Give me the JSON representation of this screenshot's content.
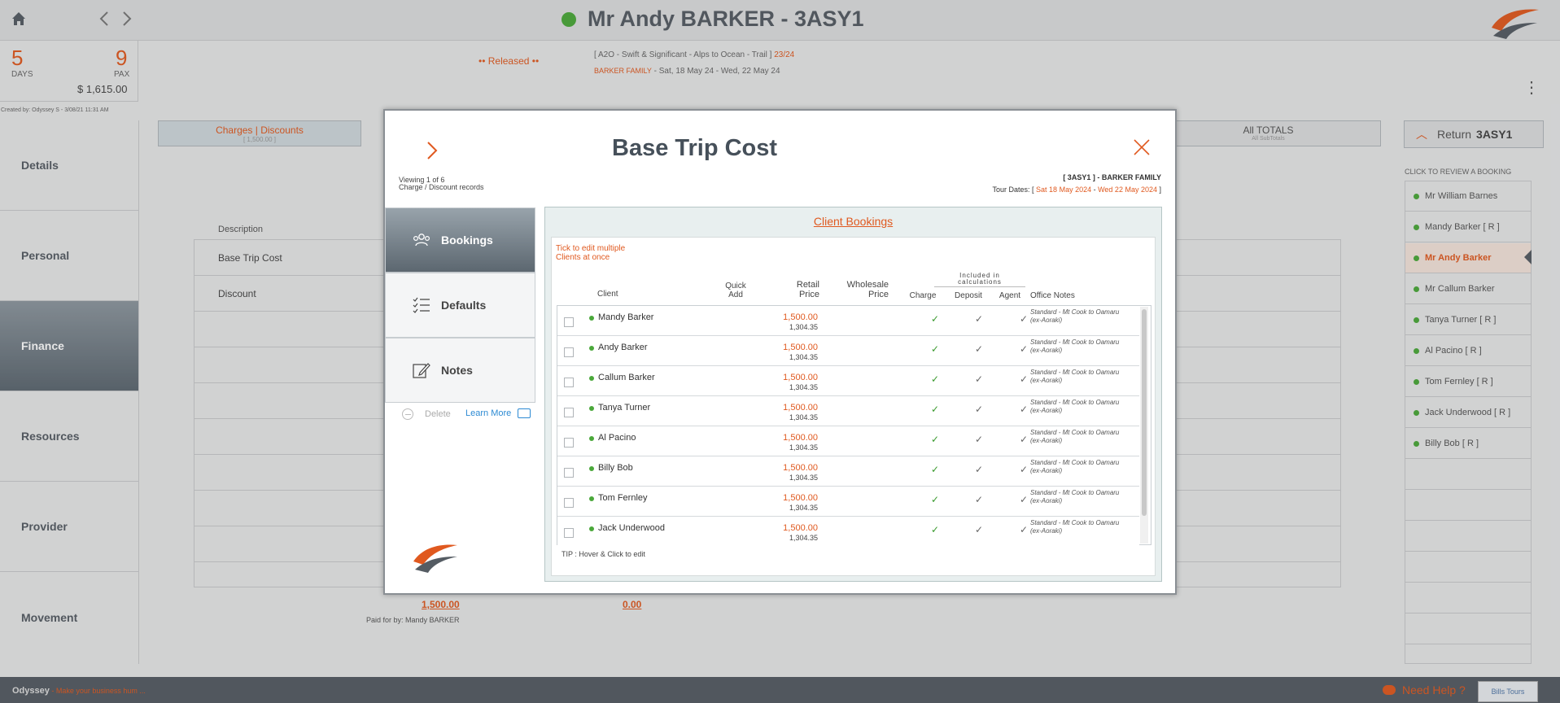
{
  "header": {
    "title": "Mr Andy BARKER - 3ASY1",
    "status_color": "#4aa83a"
  },
  "summary": {
    "days": "5",
    "days_label": "DAYS",
    "pax": "9",
    "pax_label": "PAX",
    "total": "$ 1,615.00",
    "created_by": "Created by: Odyssey S - 3/08/21 11:31 AM"
  },
  "nav": {
    "items": [
      {
        "label": "Details"
      },
      {
        "label": "Personal"
      },
      {
        "label": "Finance"
      },
      {
        "label": "Resources"
      },
      {
        "label": "Provider"
      },
      {
        "label": "Movement"
      }
    ]
  },
  "trip": {
    "released": "•• Released ••",
    "line1_prefix": "[ A2O - Swift & Significant - Alps to Ocean - Trail ]",
    "line1_code": "23/24",
    "line2_family": "BARKER FAMILY",
    "line2_dates": "- Sat, 18 May 24 - Wed, 22 May 24"
  },
  "tabs": {
    "charges_label": "Charges | Discounts",
    "charges_sub": "[ 1,500.00 ]",
    "alltotals_label": "All TOTALS",
    "alltotals_sub": "All SubTotals"
  },
  "background_table": {
    "desc_header": "Description",
    "rows": [
      "Base Trip Cost",
      "Discount"
    ],
    "sum1": "1,500.00",
    "sum2": "0.00",
    "paid_for": "Paid for by: Mandy BARKER"
  },
  "right_panel": {
    "return_label": "Return",
    "return_code": "3ASY1",
    "review_title": "CLICK TO REVIEW A BOOKING",
    "bookings": [
      "Mr William Barnes",
      "Mandy Barker  [ R ]",
      "Mr Andy Barker",
      "Mr Callum Barker",
      "Tanya Turner  [ R ]",
      "Al Pacino  [ R ]",
      "Tom Fernley  [ R ]",
      "Jack Underwood  [ R ]",
      "Billy Bob  [ R ]"
    ]
  },
  "footer": {
    "brand": "Odyssey",
    "tagline": " - Make your business hum ...",
    "help": "Need Help ?",
    "partner_logo": "Bills Tours"
  },
  "modal": {
    "title": "Base Trip Cost",
    "viewing_line1": "Viewing 1 of 6",
    "viewing_line2": "Charge / Discount records",
    "trip_code": "[ 3ASY1 ] - BARKER FAMILY",
    "tour_dates_prefix": "Tour Dates: [",
    "tour_date_start": "Sat 18 May 2024",
    "tour_date_sep": " - ",
    "tour_date_end": "Wed 22 May 2024",
    "tour_dates_suffix": " ]",
    "side_tabs": [
      {
        "label": "Bookings",
        "icon": "people-icon"
      },
      {
        "label": "Defaults",
        "icon": "list-icon"
      },
      {
        "label": "Notes",
        "icon": "edit-icon"
      }
    ],
    "delete_label": "Delete",
    "learn_more_label": "Learn More",
    "panel_title": "Client Bookings",
    "tick_note_1": "Tick to edit multiple",
    "tick_note_2": "Clients at once",
    "headers": {
      "client": "Client",
      "quick_add": "Quick\nAdd",
      "retail": "Retail\nPrice",
      "wholesale": "Wholesale\nPrice",
      "included": "Included in\ncalculations",
      "charge": "Charge",
      "deposit": "Deposit",
      "agent": "Agent",
      "office_notes": "Office Notes"
    },
    "clients": [
      {
        "name": "Mandy Barker",
        "retail": "1,500.00",
        "wholesale": "1,304.35",
        "notes": "Standard - Mt Cook to Oamaru (ex-Aoraki)"
      },
      {
        "name": "Andy Barker",
        "retail": "1,500.00",
        "wholesale": "1,304.35",
        "notes": "Standard - Mt Cook to Oamaru (ex-Aoraki)"
      },
      {
        "name": "Callum Barker",
        "retail": "1,500.00",
        "wholesale": "1,304.35",
        "notes": "Standard - Mt Cook to Oamaru (ex-Aoraki)"
      },
      {
        "name": "Tanya Turner",
        "retail": "1,500.00",
        "wholesale": "1,304.35",
        "notes": "Standard - Mt Cook to Oamaru (ex-Aoraki)"
      },
      {
        "name": "Al Pacino",
        "retail": "1,500.00",
        "wholesale": "1,304.35",
        "notes": "Standard - Mt Cook to Oamaru (ex-Aoraki)"
      },
      {
        "name": "Billy Bob",
        "retail": "1,500.00",
        "wholesale": "1,304.35",
        "notes": "Standard - Mt Cook to Oamaru (ex-Aoraki)"
      },
      {
        "name": "Tom Fernley",
        "retail": "1,500.00",
        "wholesale": "1,304.35",
        "notes": "Standard - Mt Cook to Oamaru (ex-Aoraki)"
      },
      {
        "name": "Jack Underwood",
        "retail": "1,500.00",
        "wholesale": "1,304.35",
        "notes": "Standard - Mt Cook to Oamaru (ex-Aoraki)"
      }
    ],
    "check_glyph": "✓",
    "tip": "TIP : Hover & Click to edit"
  },
  "colors": {
    "accent": "#e0591f",
    "status_green": "#4aa83a",
    "nav_active": "#5c6770",
    "link_blue": "#2c8ad3"
  }
}
